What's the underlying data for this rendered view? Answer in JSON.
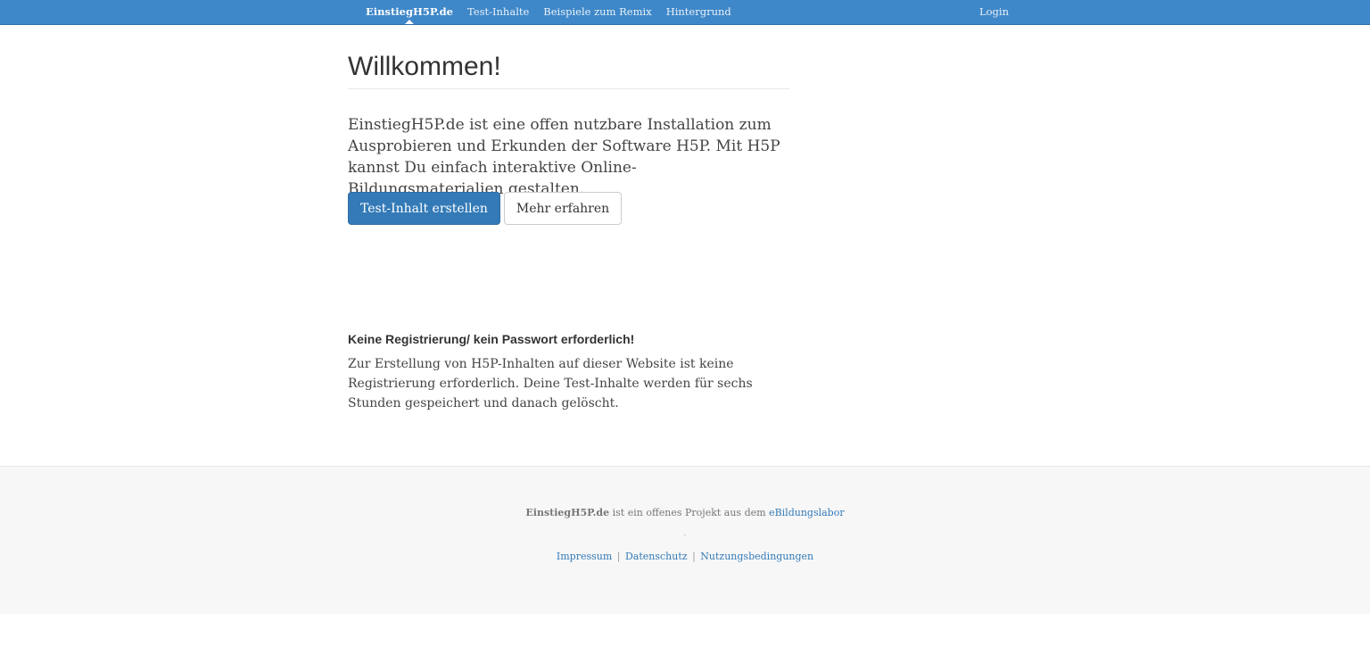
{
  "navbar": {
    "brand": "EinstiegH5P.de",
    "items": [
      {
        "label": "Test-Inhalte"
      },
      {
        "label": "Beispiele zum Remix"
      },
      {
        "label": "Hintergrund"
      }
    ],
    "login": "Login"
  },
  "main": {
    "title": "Willkommen!",
    "lead": "EinstiegH5P.de ist eine offen nutzbare Installation zum Ausprobieren und Erkunden der Software H5P. Mit H5P kannst Du einfach interaktive Online-Bildungsmaterialien gestalten.",
    "primary_button": "Test-Inhalt erstellen",
    "secondary_button": "Mehr erfahren",
    "note_heading": "Keine Registrierung/ kein Passwort erforderlich!",
    "note_text": "Zur Erstellung von H5P-Inhalten auf dieser Website ist keine Registrierung erforderlich. Deine Test-Inhalte werden für sechs Stunden gespeichert und danach gelöscht."
  },
  "footer": {
    "brand": "EinstiegH5P.de",
    "text": " ist ein offenes Projekt aus dem ",
    "link": "eBildungslabor",
    "dot": ".",
    "links": [
      {
        "label": "Impressum"
      },
      {
        "label": "Datenschutz"
      },
      {
        "label": "Nutzungsbedingungen"
      }
    ],
    "separator": "|"
  },
  "colors": {
    "navbar": "#3e87c8",
    "primary": "#337ab7",
    "footer_bg": "#f7f7f7"
  }
}
